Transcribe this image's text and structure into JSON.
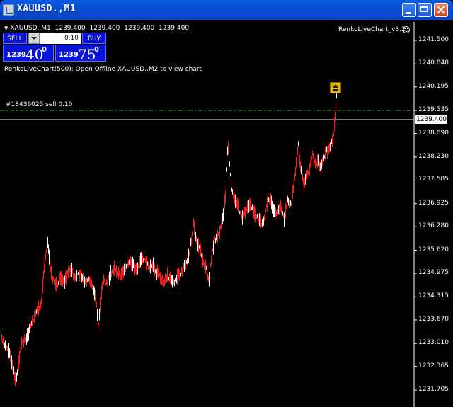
{
  "window": {
    "title": "XAUUSD.,M1",
    "icon": "chart-window-icon"
  },
  "chart_header": {
    "symbol": "XAUUSD.,M1",
    "ohlc": [
      "1239.400",
      "1239.400",
      "1239.400",
      "1239.400"
    ],
    "indicator": "RenkoLiveChart_v3.2"
  },
  "trade_panel": {
    "sell_label": "SELL",
    "buy_label": "BUY",
    "lot_value": "0.10",
    "sell_price": {
      "big": "1239",
      "pips": "40",
      "fraction": "0"
    },
    "buy_price": {
      "big": "1239",
      "pips": "75",
      "fraction": "0"
    }
  },
  "comment": "RenkoLiveChart(500): Open Offline XAUUSD.,M2 to view chart",
  "order_line": {
    "label": "#18436025 sell 0.10",
    "price": 1239.535,
    "color": "#3a9a3a"
  },
  "current_price": {
    "label": "1239.400",
    "value": 1239.4,
    "color": "#c0c0c0"
  },
  "colors": {
    "background": "#000000",
    "bars": "#ff1818",
    "axis": "#ffffff",
    "titlebar": "#0b4cd0"
  },
  "chart_data": {
    "type": "line",
    "y_ticks": [
      "1241.500",
      "1240.840",
      "1240.195",
      "1239.535",
      "1238.890",
      "1238.230",
      "1237.585",
      "1236.925",
      "1236.280",
      "1235.620",
      "1234.975",
      "1234.315",
      "1233.670",
      "1233.010",
      "1232.365",
      "1231.705"
    ],
    "ylim": [
      1231.6,
      1242.2
    ],
    "series": [
      {
        "color": "#ff1818",
        "x": [
          0,
          5,
          12,
          18,
          22,
          25,
          30,
          38,
          45,
          52,
          58,
          63,
          67,
          70,
          73,
          76,
          80,
          85,
          90,
          95,
          100,
          105,
          110,
          115,
          120,
          125,
          130,
          133,
          136,
          138,
          141,
          145,
          150,
          155,
          160,
          165,
          170,
          175,
          180,
          185,
          190,
          195,
          200,
          205,
          210,
          215,
          220,
          225,
          230,
          235,
          240,
          245,
          250,
          255,
          260,
          265,
          270,
          272,
          274,
          278,
          282,
          286,
          290,
          294,
          298,
          302,
          306,
          310,
          314,
          318,
          320,
          322,
          324,
          326,
          330,
          335,
          340,
          345,
          350,
          355,
          360,
          365,
          370,
          375,
          380,
          385,
          390,
          395,
          400,
          405,
          410,
          415,
          418,
          420,
          422,
          425,
          428,
          432,
          436,
          440,
          444,
          448,
          452,
          456,
          460,
          464,
          468,
          470,
          472,
          474
        ],
        "y": [
          1233.3,
          1233.0,
          1232.8,
          1232.3,
          1231.9,
          1232.4,
          1233.0,
          1233.2,
          1233.6,
          1233.9,
          1234.2,
          1235.4,
          1235.8,
          1235.2,
          1234.9,
          1234.7,
          1234.6,
          1234.9,
          1234.7,
          1235.0,
          1235.1,
          1234.8,
          1235.0,
          1234.9,
          1234.7,
          1234.8,
          1234.6,
          1234.4,
          1234.0,
          1233.4,
          1234.2,
          1234.8,
          1234.7,
          1234.9,
          1235.1,
          1235.0,
          1234.9,
          1235.1,
          1235.2,
          1235.3,
          1235.1,
          1235.2,
          1235.4,
          1235.3,
          1235.1,
          1235.2,
          1235.0,
          1234.9,
          1234.7,
          1234.9,
          1234.8,
          1234.7,
          1234.9,
          1235.0,
          1235.2,
          1235.4,
          1236.0,
          1236.5,
          1236.2,
          1235.8,
          1235.6,
          1235.3,
          1235.1,
          1234.8,
          1235.5,
          1235.9,
          1236.0,
          1236.2,
          1236.6,
          1237.2,
          1238.3,
          1238.6,
          1237.8,
          1237.3,
          1237.1,
          1236.9,
          1236.5,
          1236.7,
          1236.9,
          1236.8,
          1236.6,
          1236.5,
          1236.3,
          1236.8,
          1237.1,
          1236.7,
          1236.6,
          1236.9,
          1236.5,
          1237.0,
          1236.9,
          1237.6,
          1238.2,
          1238.6,
          1238.1,
          1237.7,
          1237.5,
          1237.7,
          1237.9,
          1238.3,
          1238.0,
          1238.1,
          1237.9,
          1238.2,
          1238.4,
          1238.5,
          1238.7,
          1238.9,
          1239.4,
          1239.9
        ]
      }
    ]
  }
}
